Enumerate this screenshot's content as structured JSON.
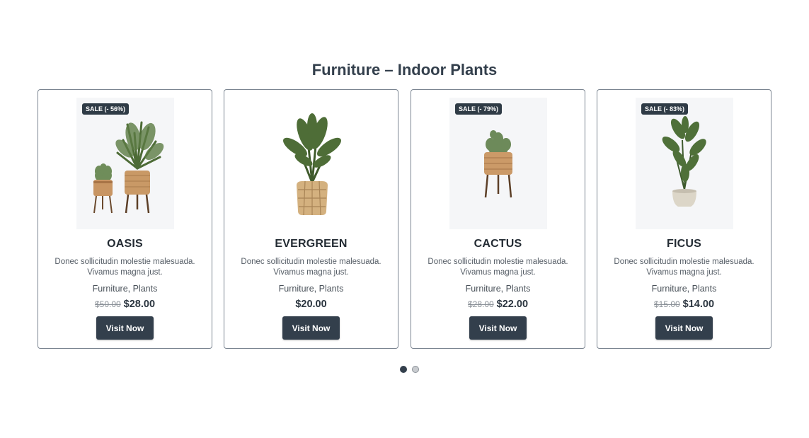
{
  "section": {
    "title": "Furniture – Indoor Plants"
  },
  "products": [
    {
      "badge": "SALE (- 56%)",
      "name": "OASIS",
      "description": "Donec sollicitudin molestie malesuada. Vivamus magna just.",
      "categories": "Furniture, Plants",
      "old_price": "$50.00",
      "price": "$28.00",
      "button": "Visit Now",
      "image": "two-potted-palms-on-stands"
    },
    {
      "badge": "",
      "name": "EVERGREEN",
      "description": "Donec sollicitudin molestie malesuada. Vivamus magna just.",
      "categories": "Furniture, Plants",
      "old_price": "",
      "price": "$20.00",
      "button": "Visit Now",
      "image": "palm-in-wicker-basket"
    },
    {
      "badge": "SALE (- 79%)",
      "name": "CACTUS",
      "description": "Donec sollicitudin molestie malesuada. Vivamus magna just.",
      "categories": "Furniture, Plants",
      "old_price": "$28.00",
      "price": "$22.00",
      "button": "Visit Now",
      "image": "cactus-on-stand"
    },
    {
      "badge": "SALE (- 83%)",
      "name": "FICUS",
      "description": "Donec sollicitudin molestie malesuada. Vivamus magna just.",
      "categories": "Furniture, Plants",
      "old_price": "$15.00",
      "price": "$14.00",
      "button": "Visit Now",
      "image": "ficus-in-white-pot"
    }
  ],
  "pagination": {
    "pages": 2,
    "active": 1
  }
}
